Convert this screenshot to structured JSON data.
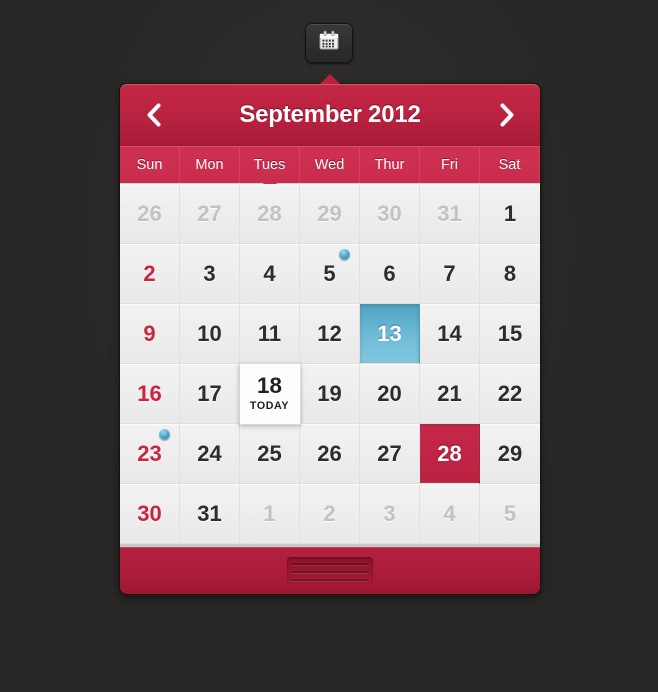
{
  "toggle": {
    "icon": "calendar-icon",
    "label": "Calendar"
  },
  "header": {
    "prev_icon": "chevron-left-icon",
    "next_icon": "chevron-right-icon",
    "title": "September 2012"
  },
  "weekdays": [
    "Sun",
    "Mon",
    "Tues",
    "Wed",
    "Thur",
    "Fri",
    "Sat"
  ],
  "today": {
    "number": "18",
    "label": "TODAY",
    "weekday_index": 2
  },
  "colors": {
    "header_red": "#bd2442",
    "weekday_red": "#c92c4c",
    "footer_red": "#ab1c39",
    "selected_red": "#c6284a",
    "sunday_red": "#c9253f",
    "highlight_blue": "#6fbcd7",
    "event_dot_blue": "#3f9dc6",
    "cell_grey": "#eeeeee",
    "muted_grey": "#c2c2c2",
    "background": "#262423"
  },
  "footer": {
    "grip_icon": "drag-grip-icon"
  },
  "days": [
    {
      "n": "26",
      "state": "muted"
    },
    {
      "n": "27",
      "state": "muted"
    },
    {
      "n": "28",
      "state": "muted"
    },
    {
      "n": "29",
      "state": "muted"
    },
    {
      "n": "30",
      "state": "muted"
    },
    {
      "n": "31",
      "state": "muted"
    },
    {
      "n": "1",
      "state": "normal"
    },
    {
      "n": "2",
      "state": "sunday"
    },
    {
      "n": "3",
      "state": "normal"
    },
    {
      "n": "4",
      "state": "normal"
    },
    {
      "n": "5",
      "state": "normal",
      "dot": true
    },
    {
      "n": "6",
      "state": "normal"
    },
    {
      "n": "7",
      "state": "normal"
    },
    {
      "n": "8",
      "state": "normal"
    },
    {
      "n": "9",
      "state": "sunday"
    },
    {
      "n": "10",
      "state": "normal"
    },
    {
      "n": "11",
      "state": "normal"
    },
    {
      "n": "12",
      "state": "normal"
    },
    {
      "n": "13",
      "state": "highlight"
    },
    {
      "n": "14",
      "state": "normal"
    },
    {
      "n": "15",
      "state": "normal"
    },
    {
      "n": "16",
      "state": "sunday"
    },
    {
      "n": "17",
      "state": "normal"
    },
    {
      "n": "18",
      "state": "today"
    },
    {
      "n": "19",
      "state": "normal"
    },
    {
      "n": "20",
      "state": "normal"
    },
    {
      "n": "21",
      "state": "normal"
    },
    {
      "n": "22",
      "state": "normal"
    },
    {
      "n": "23",
      "state": "sunday",
      "dot": true
    },
    {
      "n": "24",
      "state": "normal"
    },
    {
      "n": "25",
      "state": "normal"
    },
    {
      "n": "26",
      "state": "normal"
    },
    {
      "n": "27",
      "state": "normal"
    },
    {
      "n": "28",
      "state": "selected"
    },
    {
      "n": "29",
      "state": "normal"
    },
    {
      "n": "30",
      "state": "sunday"
    },
    {
      "n": "31",
      "state": "normal"
    },
    {
      "n": "1",
      "state": "muted"
    },
    {
      "n": "2",
      "state": "muted"
    },
    {
      "n": "3",
      "state": "muted"
    },
    {
      "n": "4",
      "state": "muted"
    },
    {
      "n": "5",
      "state": "muted"
    }
  ]
}
